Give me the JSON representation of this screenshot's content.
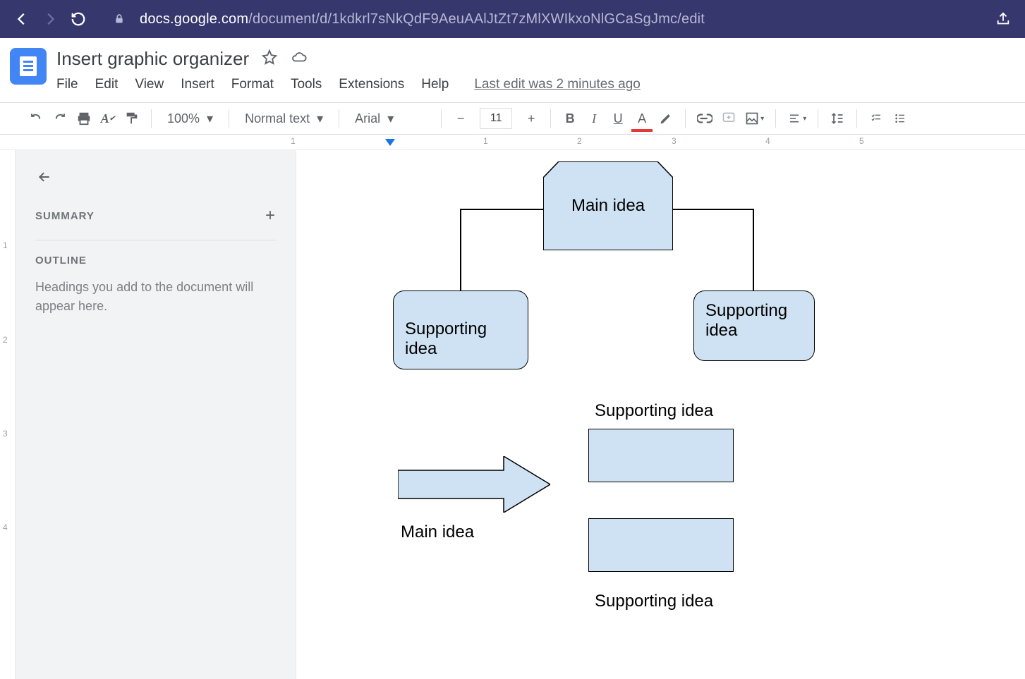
{
  "browser": {
    "url_host": "docs.google.com",
    "url_path": "/document/d/1kdkrl7sNkQdF9AeuAAlJtZt7zMlXWIkxoNlGCaSgJmc/edit"
  },
  "doc": {
    "title": "Insert graphic organizer",
    "menus": [
      "File",
      "Edit",
      "View",
      "Insert",
      "Format",
      "Tools",
      "Extensions",
      "Help"
    ],
    "edit_status": "Last edit was 2 minutes ago"
  },
  "toolbar": {
    "zoom": "100%",
    "style": "Normal text",
    "font": "Arial",
    "font_size": "11"
  },
  "sidebar": {
    "summary_label": "SUMMARY",
    "outline_label": "OUTLINE",
    "placeholder": "Headings you add to the document will appear here."
  },
  "ruler": {
    "h": [
      "1",
      "1",
      "2",
      "3",
      "4",
      "5"
    ],
    "v": [
      "1",
      "2",
      "3",
      "4"
    ]
  },
  "shapes": {
    "main_top": "Main idea",
    "support_left": "Supporting idea",
    "support_right": "Supporting idea",
    "label_support_top": "Supporting idea",
    "label_main_bottom": "Main idea",
    "label_support_bottom": "Supporting idea"
  },
  "icons": {
    "minus": "−",
    "plus": "+",
    "bold": "B",
    "italic": "I",
    "underline": "U",
    "textcolor": "A"
  }
}
